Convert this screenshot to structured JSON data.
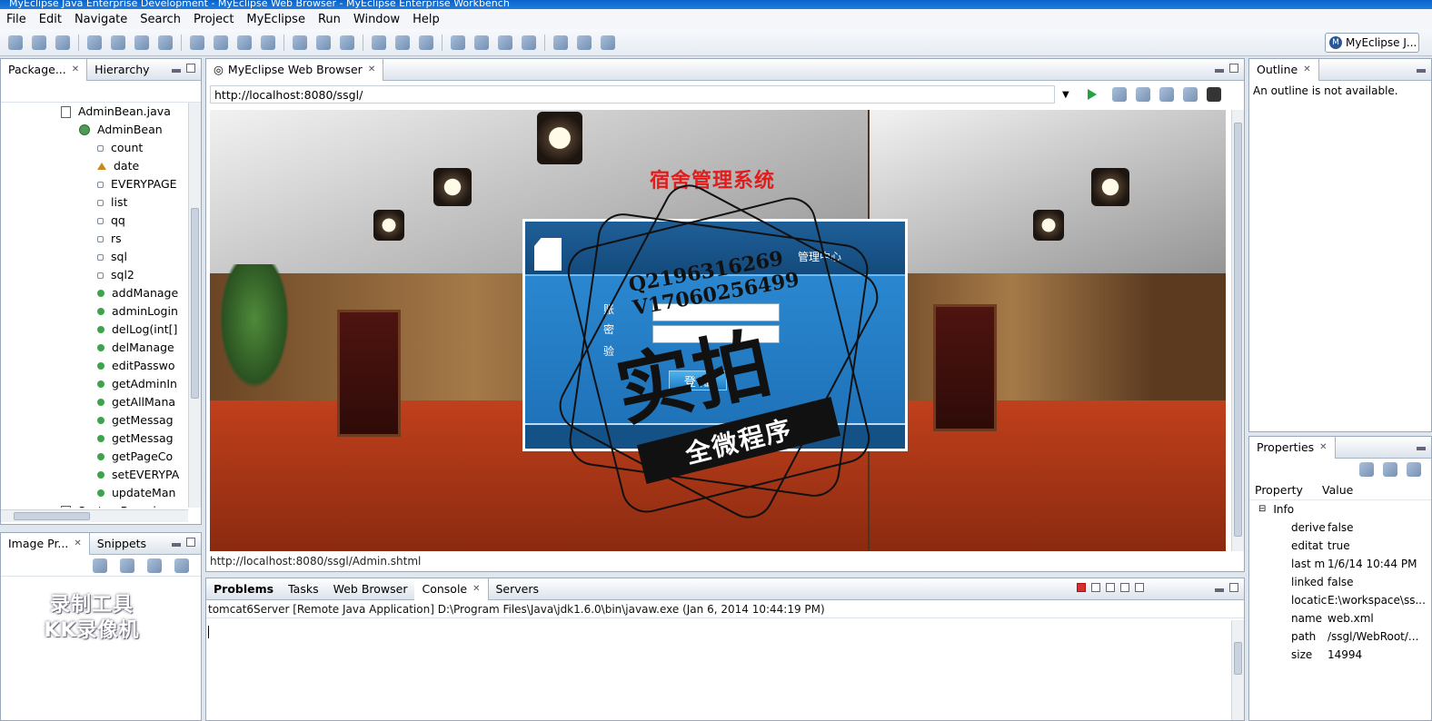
{
  "window": {
    "title": "MyEclipse Java Enterprise Development - MyEclipse Web Browser - MyEclipse Enterprise Workbench"
  },
  "menu": [
    "File",
    "Edit",
    "Navigate",
    "Search",
    "Project",
    "MyEclipse",
    "Run",
    "Window",
    "Help"
  ],
  "perspective": {
    "label": "MyEclipse J..."
  },
  "package_explorer": {
    "tabs": [
      "Package...",
      "Hierarchy"
    ],
    "items": [
      {
        "label": "AdminBean.java",
        "type": "file",
        "indent": 0
      },
      {
        "label": "AdminBean",
        "type": "class",
        "indent": 1
      },
      {
        "label": "count",
        "type": "field",
        "indent": 2
      },
      {
        "label": "date",
        "type": "field-tri",
        "indent": 2
      },
      {
        "label": "EVERYPAGE",
        "type": "field",
        "indent": 2
      },
      {
        "label": "list",
        "type": "field",
        "indent": 2
      },
      {
        "label": "qq",
        "type": "field",
        "indent": 2
      },
      {
        "label": "rs",
        "type": "field",
        "indent": 2
      },
      {
        "label": "sql",
        "type": "field",
        "indent": 2
      },
      {
        "label": "sql2",
        "type": "field",
        "indent": 2
      },
      {
        "label": "addManage",
        "type": "method",
        "indent": 2
      },
      {
        "label": "adminLogin",
        "type": "method",
        "indent": 2
      },
      {
        "label": "delLog(int[]",
        "type": "method",
        "indent": 2
      },
      {
        "label": "delManage",
        "type": "method",
        "indent": 2
      },
      {
        "label": "editPasswo",
        "type": "method",
        "indent": 2
      },
      {
        "label": "getAdminIn",
        "type": "method",
        "indent": 2
      },
      {
        "label": "getAllMana",
        "type": "method",
        "indent": 2
      },
      {
        "label": "getMessag",
        "type": "method",
        "indent": 2
      },
      {
        "label": "getMessag",
        "type": "method",
        "indent": 2
      },
      {
        "label": "getPageCo",
        "type": "method",
        "indent": 2
      },
      {
        "label": "setEVERYPA",
        "type": "method",
        "indent": 2
      },
      {
        "label": "updateMan",
        "type": "method",
        "indent": 2
      },
      {
        "label": "SystemBean.java",
        "type": "file",
        "indent": 0
      }
    ]
  },
  "image_preview": {
    "tabs": [
      "Image Pr...",
      "Snippets"
    ],
    "watermark": [
      "录制工具",
      "KK录像机"
    ]
  },
  "browser": {
    "tab": "MyEclipse Web Browser",
    "url": "http://localhost:8080/ssgl/",
    "status_url": "http://localhost:8080/ssgl/Admin.shtml",
    "page": {
      "system_title": "宿舍管理系统",
      "login_center": "管理中心",
      "labels": [
        "账",
        "密",
        "验"
      ],
      "login_button": "登 陆"
    },
    "stamp": {
      "qq": "Q2196316269",
      "vx": "V17060256499",
      "big": "实拍",
      "ribbon": "全微程序"
    }
  },
  "console": {
    "tabs": [
      "Problems",
      "Tasks",
      "Web Browser",
      "Console",
      "Servers"
    ],
    "active_tab": "Console",
    "header": "tomcat6Server [Remote Java Application] D:\\Program Files\\Java\\jdk1.6.0\\bin\\javaw.exe (Jan 6, 2014 10:44:19 PM)"
  },
  "outline": {
    "tab": "Outline",
    "message": "An outline is not available."
  },
  "properties": {
    "tab": "Properties",
    "col_property": "Property",
    "col_value": "Value",
    "group": "Info",
    "rows": [
      {
        "key": "derive",
        "value": "false"
      },
      {
        "key": "editat",
        "value": "true"
      },
      {
        "key": "last m",
        "value": "1/6/14 10:44 PM"
      },
      {
        "key": "linked",
        "value": "false"
      },
      {
        "key": "locatic",
        "value": "E:\\workspace\\ss..."
      },
      {
        "key": "name",
        "value": "web.xml"
      },
      {
        "key": "path",
        "value": "/ssgl/WebRoot/..."
      },
      {
        "key": "size",
        "value": "14994"
      }
    ]
  }
}
